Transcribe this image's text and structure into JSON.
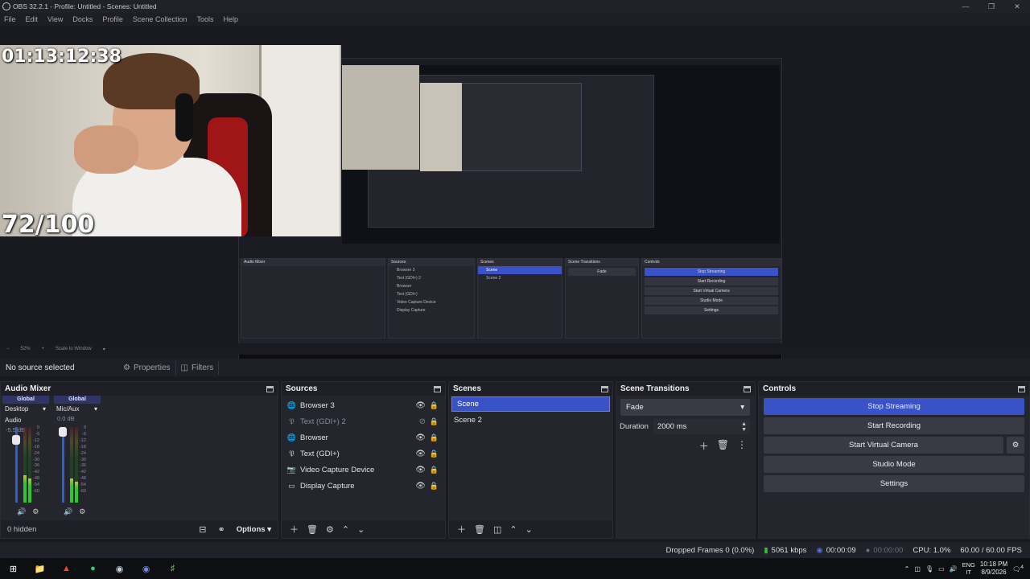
{
  "window": {
    "title": "OBS 32.2.1 - Profile: Untitled - Scenes: Untitled"
  },
  "menu": [
    "File",
    "Edit",
    "View",
    "Docks",
    "Profile",
    "Scene Collection",
    "Tools",
    "Help"
  ],
  "preview": {
    "timer": "01:13:12:38",
    "score": "72/100",
    "zoom": "52%",
    "scale_mode": "Scale to Window"
  },
  "context": {
    "no_source": "No source selected",
    "properties": "Properties",
    "filters": "Filters"
  },
  "audio_mixer": {
    "title": "Audio Mixer",
    "channels": [
      {
        "global": "Global",
        "name": "Desktop Audio",
        "db": "-5.5 dB",
        "level": 0.88,
        "meter": 0.36
      },
      {
        "global": "Global",
        "name": "Mic/Aux",
        "db": "0.0 dB",
        "level": 1.0,
        "meter": 0.32
      }
    ],
    "scale": [
      "0",
      "-6",
      "-12",
      "-18",
      "-24",
      "-30",
      "-36",
      "-42",
      "-48",
      "-54",
      "-60"
    ],
    "hidden": "0 hidden",
    "options": "Options"
  },
  "sources": {
    "title": "Sources",
    "items": [
      {
        "label": "Browser 3",
        "icon": "globe-icon",
        "visible": true
      },
      {
        "label": "Text (GDI+) 2",
        "icon": "text-icon",
        "visible": false
      },
      {
        "label": "Browser",
        "icon": "globe-icon",
        "visible": true
      },
      {
        "label": "Text (GDI+)",
        "icon": "text-icon",
        "visible": true
      },
      {
        "label": "Video Capture Device",
        "icon": "camera-icon",
        "visible": true
      },
      {
        "label": "Display Capture",
        "icon": "monitor-icon",
        "visible": true
      }
    ]
  },
  "scenes": {
    "title": "Scenes",
    "items": [
      {
        "label": "Scene",
        "selected": true
      },
      {
        "label": "Scene 2",
        "selected": false
      }
    ]
  },
  "transitions": {
    "title": "Scene Transitions",
    "selected": "Fade",
    "duration_label": "Duration",
    "duration_value": "2000 ms"
  },
  "controls": {
    "title": "Controls",
    "stop_streaming": "Stop Streaming",
    "start_recording": "Start Recording",
    "start_virtual_camera": "Start Virtual Camera",
    "studio_mode": "Studio Mode",
    "settings": "Settings"
  },
  "status": {
    "dropped_frames": "Dropped Frames 0 (0.0%)",
    "bitrate": "5061 kbps",
    "stream_time": "00:00:09",
    "record_time": "00:00:00",
    "cpu": "CPU: 1.0%",
    "fps": "60.00 / 60.00 FPS"
  },
  "taskbar": {
    "lang_top": "ENG",
    "lang_bottom": "IT",
    "time": "10:18 PM",
    "date": "8/9/2026",
    "notifications": "4"
  },
  "colors": {
    "accent": "#3952c8",
    "meter_green": "#2fc52f",
    "background": "#24252d"
  }
}
